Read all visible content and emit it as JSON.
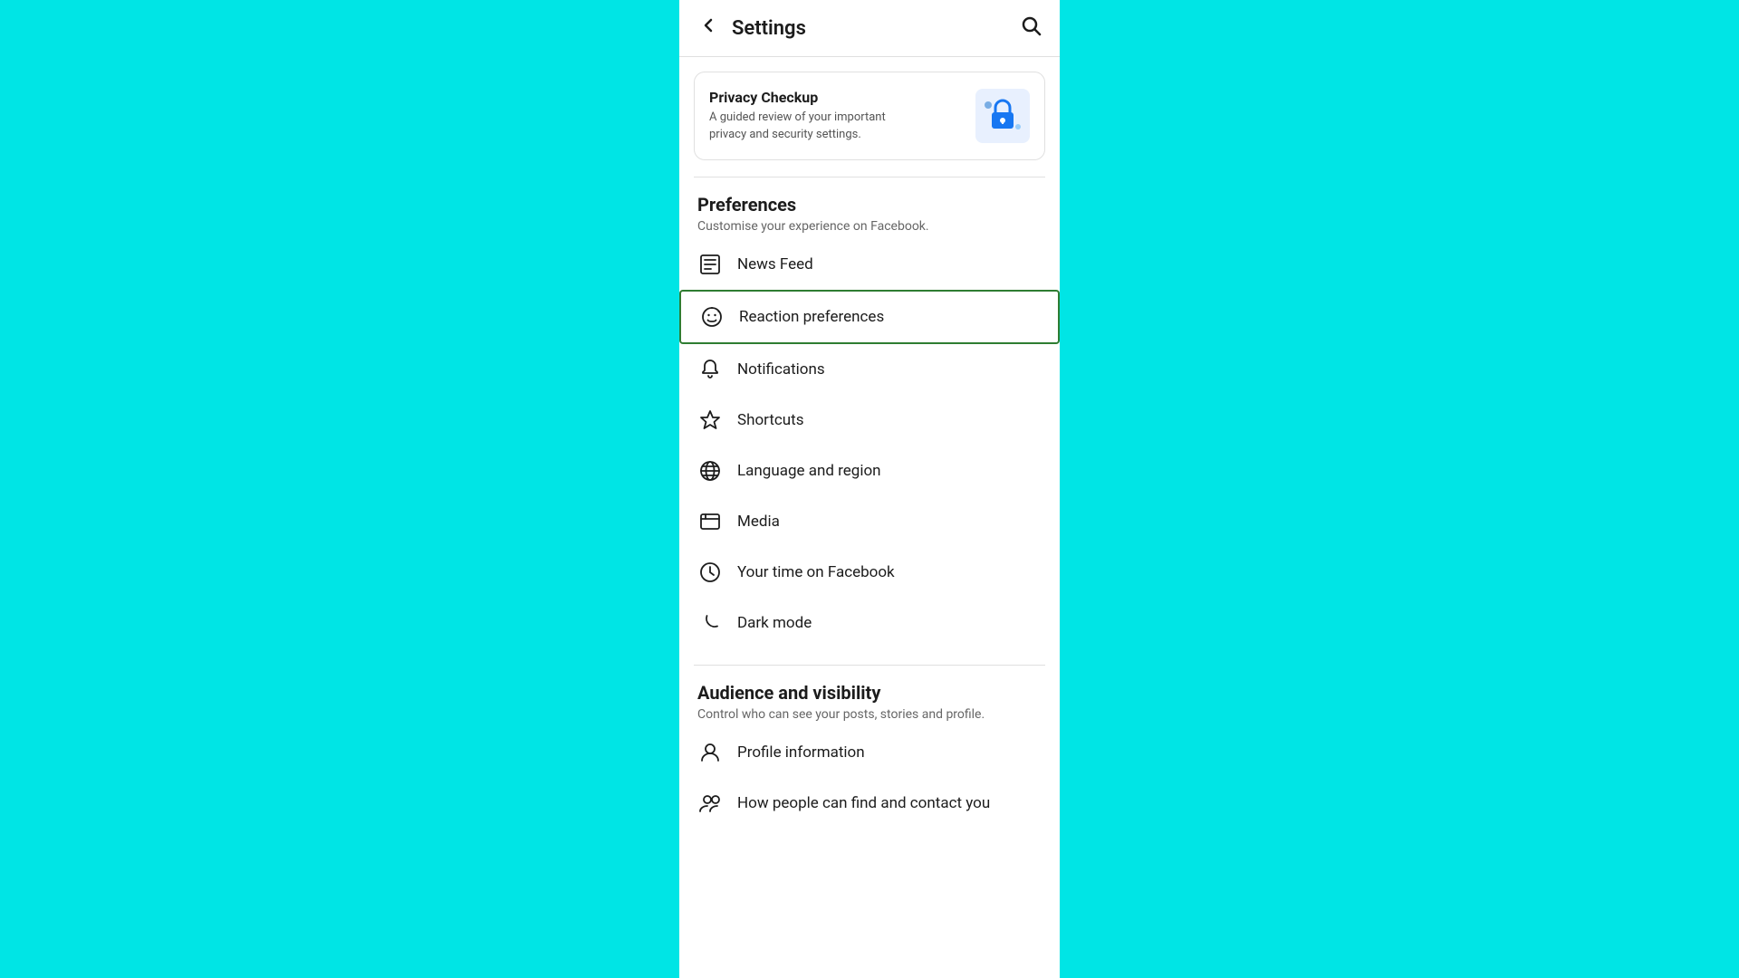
{
  "header": {
    "title": "Settings",
    "back_label": "←",
    "search_label": "🔍"
  },
  "privacy_checkup": {
    "title": "Privacy Checkup",
    "description": "A guided review of your important privacy and security settings."
  },
  "preferences_section": {
    "title": "Preferences",
    "subtitle": "Customise your experience on Facebook.",
    "items": [
      {
        "id": "news-feed",
        "label": "News Feed",
        "icon": "news-feed-icon",
        "active": false
      },
      {
        "id": "reaction-preferences",
        "label": "Reaction preferences",
        "icon": "reaction-icon",
        "active": true
      },
      {
        "id": "notifications",
        "label": "Notifications",
        "icon": "bell-icon",
        "active": false
      },
      {
        "id": "shortcuts",
        "label": "Shortcuts",
        "icon": "shortcuts-icon",
        "active": false
      },
      {
        "id": "language-region",
        "label": "Language and region",
        "icon": "globe-icon",
        "active": false
      },
      {
        "id": "media",
        "label": "Media",
        "icon": "media-icon",
        "active": false
      },
      {
        "id": "time-on-facebook",
        "label": "Your time on Facebook",
        "icon": "clock-icon",
        "active": false
      },
      {
        "id": "dark-mode",
        "label": "Dark mode",
        "icon": "moon-icon",
        "active": false
      }
    ]
  },
  "audience_section": {
    "title": "Audience and visibility",
    "subtitle": "Control who can see your posts, stories and profile.",
    "items": [
      {
        "id": "profile-information",
        "label": "Profile information",
        "icon": "profile-icon",
        "active": false
      },
      {
        "id": "find-contact",
        "label": "How people can find and contact you",
        "icon": "find-contact-icon",
        "active": false
      }
    ]
  }
}
